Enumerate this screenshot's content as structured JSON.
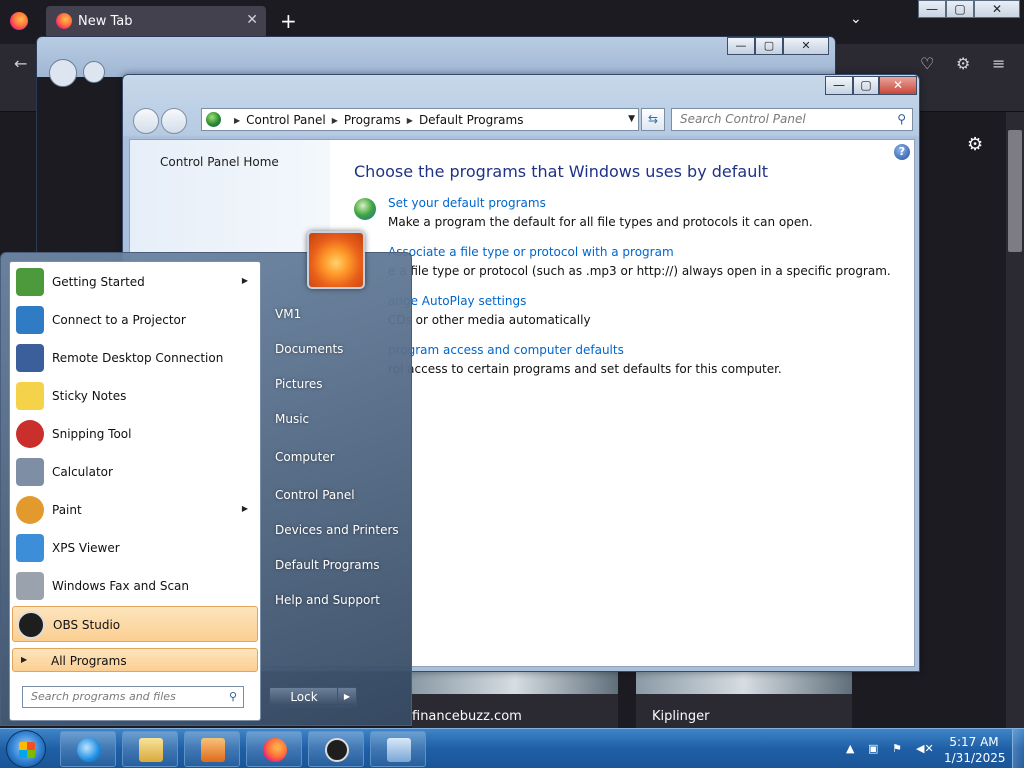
{
  "firefox": {
    "tab_title": "New Tab",
    "tab_close": "✕",
    "new_tab": "+",
    "tab_list": "⌄",
    "cards": [
      {
        "label": "financebuzz.com"
      },
      {
        "label": "Kiplinger"
      }
    ]
  },
  "window_controls": {
    "minimize": "—",
    "maximize": "▢",
    "close": "✕"
  },
  "control_panel": {
    "breadcrumbs": [
      "Control Panel",
      "Programs",
      "Default Programs"
    ],
    "search_placeholder": "Search Control Panel",
    "sidebar_home": "Control Panel Home",
    "heading": "Choose the programs that Windows uses by default",
    "tasks": [
      {
        "link": "Set your default programs",
        "desc": "Make a program the default for all file types and protocols it can open."
      },
      {
        "link": "Associate a file type or protocol with a program",
        "desc": "e a file type or protocol (such as .mp3 or http://) always open in a specific program."
      },
      {
        "link": "ange AutoPlay settings",
        "desc": "CDs or other media automatically"
      },
      {
        "link": "program access and computer defaults",
        "desc": "rol access to certain programs and set defaults for this computer."
      }
    ]
  },
  "start_menu": {
    "programs": [
      {
        "label": "Getting Started",
        "submenu": true,
        "icon": "getting-started-icon",
        "color": "#4d9a3c"
      },
      {
        "label": "Connect to a Projector",
        "submenu": false,
        "icon": "projector-icon",
        "color": "#2f7bc4"
      },
      {
        "label": "Remote Desktop Connection",
        "submenu": false,
        "icon": "remote-desktop-icon",
        "color": "#3a5f9a"
      },
      {
        "label": "Sticky Notes",
        "submenu": false,
        "icon": "sticky-notes-icon",
        "color": "#f4d34a"
      },
      {
        "label": "Snipping Tool",
        "submenu": false,
        "icon": "snipping-tool-icon",
        "color": "#c9302c"
      },
      {
        "label": "Calculator",
        "submenu": false,
        "icon": "calculator-icon",
        "color": "#7e8fa5"
      },
      {
        "label": "Paint",
        "submenu": true,
        "icon": "paint-icon",
        "color": "#e39a2d"
      },
      {
        "label": "XPS Viewer",
        "submenu": false,
        "icon": "xps-viewer-icon",
        "color": "#3c8ed8"
      },
      {
        "label": "Windows Fax and Scan",
        "submenu": false,
        "icon": "fax-scan-icon",
        "color": "#9aa3ad"
      },
      {
        "label": "OBS Studio",
        "submenu": false,
        "icon": "obs-icon",
        "color": "#1e1e1e"
      }
    ],
    "all_programs": "All Programs",
    "search_placeholder": "Search programs and files",
    "right_items": [
      "VM1",
      "Documents",
      "Pictures",
      "Music",
      "Computer",
      "Control Panel",
      "Devices and Printers",
      "Default Programs",
      "Help and Support"
    ],
    "lock_label": "Lock",
    "arrow": "▶"
  },
  "taskbar": {
    "time": "5:17 AM",
    "date": "1/31/2025",
    "tray_arrow": "▲"
  }
}
